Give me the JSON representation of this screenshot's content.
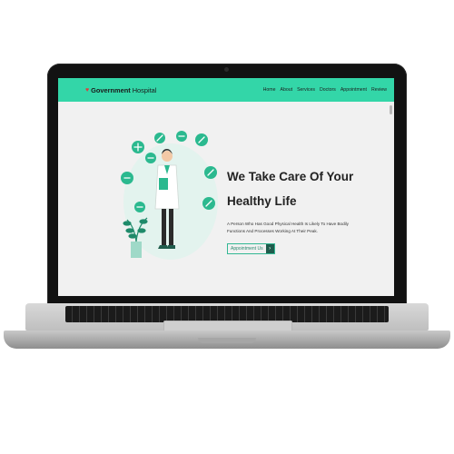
{
  "navbar": {
    "brand_bold": "Government",
    "brand_light": "Hospital",
    "links": [
      "Home",
      "About",
      "Services",
      "Doctors",
      "Appointment",
      "Review"
    ]
  },
  "hero": {
    "title_line1": "We Take Care Of Your",
    "title_line2": "Healthy Life",
    "description_line1": "A Person Who Has Good Physical Health Is Likely To Have Bodily",
    "description_line2": "Functions And Processes Working At Their Peak.",
    "cta_label": "Appointment Us",
    "cta_icon": "chevron-right-icon"
  },
  "colors": {
    "navbar": "#33d6a8",
    "accent_dark": "#1f5c4c",
    "heart": "#e03b3b"
  }
}
